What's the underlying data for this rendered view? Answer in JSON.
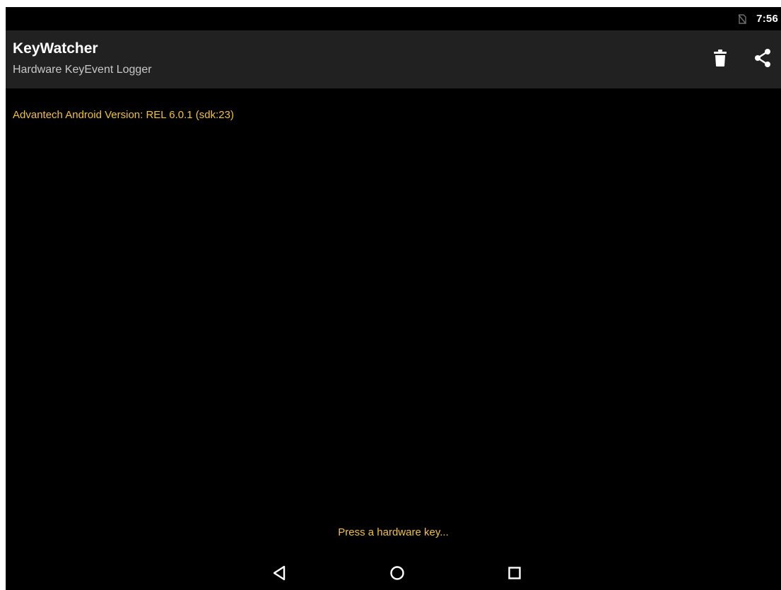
{
  "status_bar": {
    "time": "7:56",
    "signal_icon": "no-sim-icon"
  },
  "action_bar": {
    "title": "KeyWatcher",
    "subtitle": "Hardware KeyEvent Logger",
    "actions": [
      {
        "icon": "trash-icon",
        "label": "Clear log"
      },
      {
        "icon": "share-icon",
        "label": "Share"
      }
    ]
  },
  "content": {
    "version_line": "Advantech Android Version: REL 6.0.1 (sdk:23)",
    "hint": "Press a hardware key..."
  },
  "nav_bar": {
    "buttons": [
      "back-icon",
      "home-icon",
      "recents-icon"
    ]
  },
  "colors": {
    "accent_text": "#f2c230",
    "action_bar_bg": "#212121",
    "background": "#000000"
  }
}
